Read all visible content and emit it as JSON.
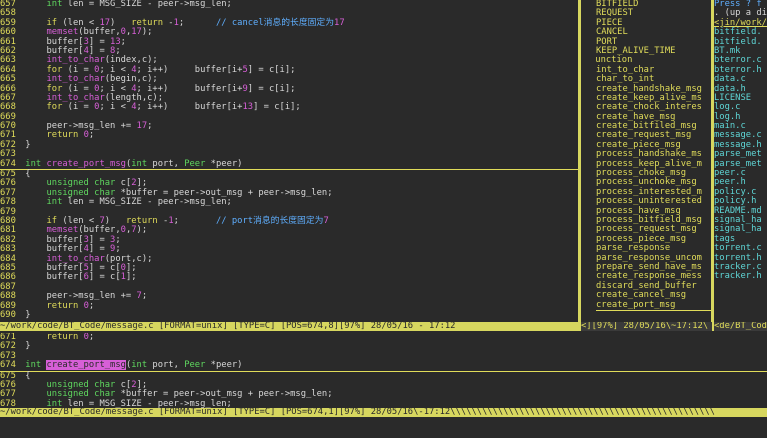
{
  "editor_top": {
    "lines": [
      {
        "n": "657",
        "t": "    int len = MSG_SIZE - peer->msg_len;"
      },
      {
        "n": "658",
        "t": ""
      },
      {
        "n": "659",
        "t": "    if (len < 17)   return -1;      // cancel消息的长度固定为17"
      },
      {
        "n": "660",
        "t": "    memset(buffer,0,17);"
      },
      {
        "n": "661",
        "t": "    buffer[3] = 13;"
      },
      {
        "n": "662",
        "t": "    buffer[4] = 8;"
      },
      {
        "n": "663",
        "t": "    int_to_char(index,c);"
      },
      {
        "n": "664",
        "t": "    for (i = 0; i < 4; i++)     buffer[i+5] = c[i];"
      },
      {
        "n": "665",
        "t": "    int_to_char(begin,c);"
      },
      {
        "n": "666",
        "t": "    for (i = 0; i < 4; i++)     buffer[i+9] = c[i];"
      },
      {
        "n": "667",
        "t": "    int_to_char(length,c);"
      },
      {
        "n": "668",
        "t": "    for (i = 0; i < 4; i++)     buffer[i+13] = c[i];"
      },
      {
        "n": "669",
        "t": ""
      },
      {
        "n": "670",
        "t": "    peer->msg_len += 17;"
      },
      {
        "n": "671",
        "t": "    return 0;"
      },
      {
        "n": "672",
        "t": "}"
      },
      {
        "n": "673",
        "t": ""
      },
      {
        "n": "674",
        "t": "int create_port_msg(int port, Peer *peer)"
      },
      {
        "n": "675",
        "t": "{"
      },
      {
        "n": "676",
        "t": "    unsigned char c[2];"
      },
      {
        "n": "677",
        "t": "    unsigned char *buffer = peer->out_msg + peer->msg_len;"
      },
      {
        "n": "678",
        "t": "    int len = MSG_SIZE - peer->msg_len;"
      },
      {
        "n": "679",
        "t": ""
      },
      {
        "n": "680",
        "t": "    if (len < 7)   return -1;       // port消息的长度固定为7"
      },
      {
        "n": "681",
        "t": "    memset(buffer,0,7);"
      },
      {
        "n": "682",
        "t": "    buffer[3] = 3;"
      },
      {
        "n": "683",
        "t": "    buffer[4] = 9;"
      },
      {
        "n": "684",
        "t": "    int_to_char(port,c);"
      },
      {
        "n": "685",
        "t": "    buffer[5] = c[0];"
      },
      {
        "n": "686",
        "t": "    buffer[6] = c[1];"
      },
      {
        "n": "687",
        "t": ""
      },
      {
        "n": "688",
        "t": "    peer->msg_len += 7;"
      },
      {
        "n": "689",
        "t": "    return 0;"
      },
      {
        "n": "690",
        "t": "}"
      }
    ]
  },
  "editor_bottom": {
    "lines": [
      {
        "n": "671",
        "t": "    return 0;"
      },
      {
        "n": "672",
        "t": "}"
      },
      {
        "n": "673",
        "t": ""
      },
      {
        "n": "674",
        "t": "int create_port_msg(int port, Peer *peer)"
      },
      {
        "n": "675",
        "t": "{"
      },
      {
        "n": "676",
        "t": "    unsigned char c[2];"
      },
      {
        "n": "677",
        "t": "    unsigned char *buffer = peer->out_msg + peer->msg_len;"
      },
      {
        "n": "678",
        "t": "    int len = MSG_SIZE - peer->msg_len;"
      }
    ]
  },
  "taglist": {
    "items_top": [
      "BITFIELD",
      "REQUEST",
      "PIECE",
      "CANCEL",
      "PORT",
      "KEEP_ALIVE_TIME"
    ],
    "header": "function",
    "functions": [
      "int_to_char",
      "char_to_int",
      "create_handshake_msg",
      "create_keep_alive_ms",
      "create_chock_interes",
      "create_have_msg",
      "create_bitfiled_msg",
      "create_request_msg",
      "create_piece_msg",
      "process_handshake_ms",
      "process_keep_alive_m",
      "process_choke_msg",
      "process_unchoke_msg",
      "process_interested_m",
      "process_uninterested",
      "process_have_msg",
      "process_bitfield_msg",
      "process_request_msg",
      "process_piece_msg",
      "parse_response",
      "parse_response_uncom",
      "prepare_send_have_ms",
      "create_response_mess",
      "discard_send_buffer",
      "create_cancel_msg",
      "create_port_msg"
    ]
  },
  "filelist": {
    "header": "Press ? f",
    "subheader": ". (up a di",
    "dir": "<jin/work/c",
    "files": [
      "bitfield.",
      "bitfield.",
      "BT.mk",
      "bterror.c",
      "bterror.h",
      "data.c",
      "data.h",
      "LICENSE",
      "log.c",
      "log.h",
      "main.c",
      "message.c",
      "message.h",
      "parse_met",
      "parse_met",
      "peer.c",
      "peer.h",
      "policy.c",
      "policy.h",
      "README.md",
      "signal_ha",
      "signal_ha",
      "tags",
      "torrent.c",
      "torrent.h",
      "tracker.c",
      "tracker.h"
    ]
  },
  "status": {
    "top": "~/work/code/BT_Code/message.c [FORMAT=unix] [TYPE=C] [POS=674,8][97%] 28/05/16 - 17:12",
    "tag": "<][97%] 28/05/16\\~17:12\\",
    "file": "<de/BT_Code",
    "bottom": "~/work/code/BT_Code/message.c [FORMAT=unix] [TYPE=C] [POS=674,1][97%] 28/05/16\\-17:12\\\\\\\\\\\\\\\\\\\\\\\\\\\\\\\\\\\\\\\\\\\\\\\\\\\\\\\\\\\\\\\\\\\\\\\\\\\\\\\\\\\\\\\\\\\\\\\\\\\\"
  },
  "colors": {
    "accent": "#d7d75f",
    "keyword": "#e0dc5a",
    "type": "#5fd75f",
    "function": "#d75fd7",
    "comment": "#5fafff"
  }
}
